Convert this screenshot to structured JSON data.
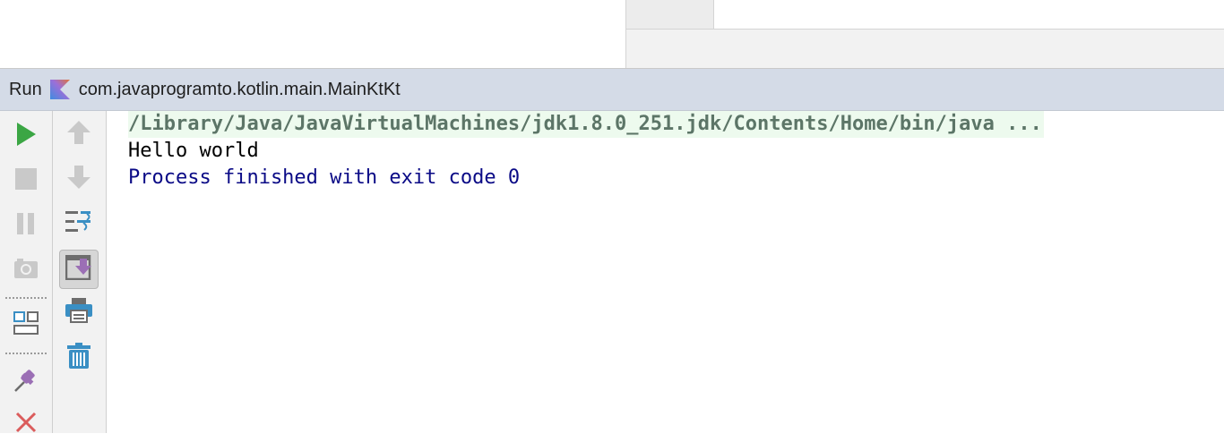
{
  "run_panel": {
    "title": "Run",
    "config_name": "com.javaprogramto.kotlin.main.MainKtKt"
  },
  "left_toolbar": [
    {
      "name": "rerun-icon",
      "icon": "play"
    },
    {
      "name": "stop-icon",
      "icon": "stop"
    },
    {
      "name": "pause-icon",
      "icon": "pause"
    },
    {
      "name": "dump-threads-icon",
      "icon": "camera"
    },
    {
      "name": "restore-layout-icon",
      "icon": "layout"
    },
    {
      "name": "pin-tab-icon",
      "icon": "pin"
    },
    {
      "name": "close-icon",
      "icon": "close"
    }
  ],
  "right_toolbar": [
    {
      "name": "up-stack-trace-icon",
      "icon": "arrow-up"
    },
    {
      "name": "down-stack-trace-icon",
      "icon": "arrow-down"
    },
    {
      "name": "soft-wrap-icon",
      "icon": "soft-wrap"
    },
    {
      "name": "scroll-to-end-icon",
      "icon": "scroll-to-end",
      "active": true
    },
    {
      "name": "print-icon",
      "icon": "print"
    },
    {
      "name": "clear-all-icon",
      "icon": "trash"
    }
  ],
  "console": {
    "command": "/Library/Java/JavaVirtualMachines/jdk1.8.0_251.jdk/Contents/Home/bin/java ...",
    "output": "Hello world",
    "exit_message": "Process finished with exit code 0"
  },
  "colors": {
    "header_bg": "#d4dbe7",
    "toolbar_bg": "#f2f2f2",
    "command_bg": "#edfaee",
    "command_text": "#5c7567",
    "exit_text": "#0a0a86",
    "run_green": "#3ba644",
    "stop_red": "#db5c5c",
    "accent_purple": "#9b6fb5",
    "accent_blue": "#3a8fc4"
  }
}
